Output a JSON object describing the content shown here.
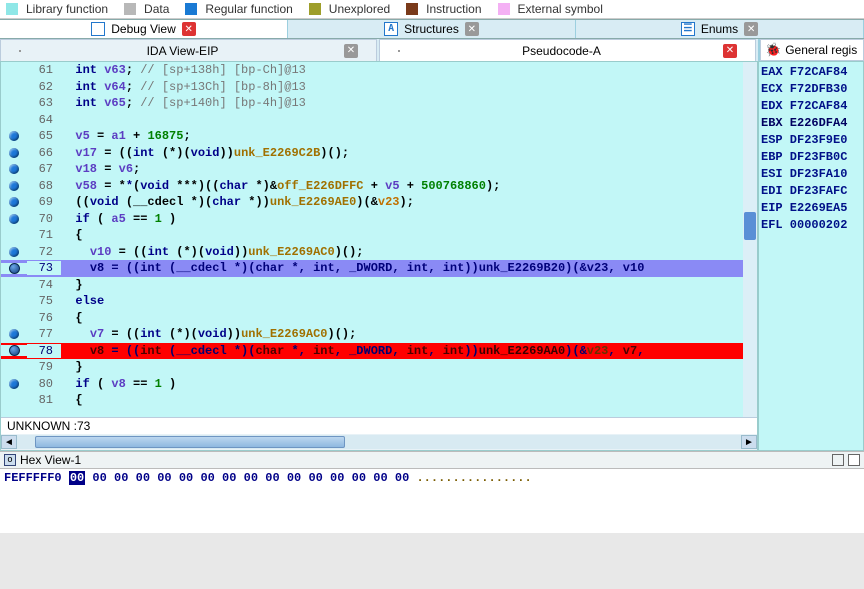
{
  "legend": [
    {
      "color": "#8fe7e7",
      "label": "Library function"
    },
    {
      "color": "#b8b8b8",
      "label": "Data"
    },
    {
      "color": "#1a7ad4",
      "label": "Regular function"
    },
    {
      "color": "#9e9e2a",
      "label": "Unexplored"
    },
    {
      "color": "#7a3a1a",
      "label": "Instruction"
    },
    {
      "color": "#f4b0f4",
      "label": "External symbol"
    }
  ],
  "main_tabs": [
    {
      "icon": "lines",
      "label": "Debug View",
      "close": "red"
    },
    {
      "icon": "A",
      "label": "Structures",
      "close": "gray"
    },
    {
      "icon": "E",
      "label": "Enums",
      "close": "gray"
    }
  ],
  "sub_tabs_left": [
    {
      "icon": "code",
      "label": "IDA View-EIP",
      "close": "gray"
    },
    {
      "icon": "code",
      "label": "Pseudocode-A",
      "close": "red"
    }
  ],
  "reg_tab_label": "General regis",
  "registers": [
    {
      "n": "EAX",
      "v": "F72CAF84"
    },
    {
      "n": "ECX",
      "v": "F72DFB30"
    },
    {
      "n": "EDX",
      "v": "F72CAF84"
    },
    {
      "n": "EBX",
      "v": "E226DFA4"
    },
    {
      "n": "ESP",
      "v": "DF23F9E0"
    },
    {
      "n": "EBP",
      "v": "DF23FB0C"
    },
    {
      "n": "ESI",
      "v": "DF23FA10"
    },
    {
      "n": "EDI",
      "v": "DF23FAFC"
    },
    {
      "n": "EIP",
      "v": "E2269EA5"
    },
    {
      "n": "EFL",
      "v": "00000202"
    }
  ],
  "code_lines": [
    {
      "ln": 61,
      "dot": "",
      "html": "  <span class='tok-kw'>int</span> <span class='tok-var'>v63</span>; <span class='tok-cmt'>// [sp+138h] [bp-Ch]@13</span>"
    },
    {
      "ln": 62,
      "dot": "",
      "html": "  <span class='tok-kw'>int</span> <span class='tok-var'>v64</span>; <span class='tok-cmt'>// [sp+13Ch] [bp-8h]@13</span>"
    },
    {
      "ln": 63,
      "dot": "",
      "html": "  <span class='tok-kw'>int</span> <span class='tok-var'>v65</span>; <span class='tok-cmt'>// [sp+140h] [bp-4h]@13</span>"
    },
    {
      "ln": 64,
      "dot": "",
      "html": ""
    },
    {
      "ln": 65,
      "dot": "d",
      "html": "  <span class='tok-var'>v5</span> = <span class='tok-var'>a1</span> + <span class='tok-num'>16875</span>;"
    },
    {
      "ln": 66,
      "dot": "d",
      "html": "  <span class='tok-var'>v17</span> = ((<span class='tok-kw'>int</span> (*)(<span class='tok-kw'>void</span>))<span class='tok-unk'>unk_E2269C2B</span>)();"
    },
    {
      "ln": 67,
      "dot": "d",
      "html": "  <span class='tok-var'>v18</span> = <span class='tok-var'>v6</span>;"
    },
    {
      "ln": 68,
      "dot": "d",
      "html": "  <span class='tok-var'>v58</span> = *<span class='tok-ptr'>*</span>(<span class='tok-kw'>void</span> ***)((<span class='tok-kw'>char</span> *)&<span class='tok-off'>off_E226DFFC</span> + <span class='tok-var'>v5</span> + <span class='tok-num'>500768860</span>);"
    },
    {
      "ln": 69,
      "dot": "d",
      "html": "  ((<span class='tok-kw'>void</span> (__cdecl *)(<span class='tok-kw'>char</span> *))<span class='tok-unk'>unk_E2269AE0</span>)(&<span class='tok-amp'>v23</span>);"
    },
    {
      "ln": 70,
      "dot": "d",
      "html": "  <span class='tok-kw'>if</span> ( <span class='tok-var'>a5</span> == <span class='tok-num'>1</span> )"
    },
    {
      "ln": 71,
      "dot": "",
      "html": "  {"
    },
    {
      "ln": 72,
      "dot": "d",
      "html": "    <span class='tok-var'>v10</span> = ((<span class='tok-kw'>int</span> (*)(<span class='tok-kw'>void</span>))<span class='tok-unk'>unk_E2269AC0</span>)();"
    },
    {
      "ln": 73,
      "dot": "b",
      "row": "sel",
      "html": "    <span class='tok-var'>v8</span> = ((<span class='tok-kw'>int</span> (__cdecl *)(<span class='tok-kw'>char</span> *, <span class='tok-kw'>int</span>, _DWORD, <span class='tok-kw'>int</span>, <span class='tok-kw'>int</span>))<span class='tok-unk'>unk_E2269B20</span>)(&<span class='tok-amp'>v23</span>, <span class='tok-var'>v10</span>"
    },
    {
      "ln": 74,
      "dot": "",
      "html": "  }"
    },
    {
      "ln": 75,
      "dot": "",
      "html": "  <span class='tok-kw'>else</span>"
    },
    {
      "ln": 76,
      "dot": "",
      "html": "  {"
    },
    {
      "ln": 77,
      "dot": "d",
      "html": "    <span class='tok-var'>v7</span> = ((<span class='tok-kw'>int</span> (*)(<span class='tok-kw'>void</span>))<span class='tok-unk'>unk_E2269AC0</span>)();"
    },
    {
      "ln": 78,
      "dot": "b",
      "row": "red",
      "html": "    <span style='color:#4a0000'>v8</span> = ((<span style='color:#4a0000'>int</span> (__cdecl *)(<span style='color:#4a0000'>char</span> *, <span style='color:#4a0000'>int</span>, _DWORD, <span style='color:#4a0000'>int</span>, <span style='color:#4a0000'>int</span>))<span class='tok-unk2' style='color:#3a0000'>unk_E2269AA0</span>)(&<span style='color:#6a3000'>v23</span>, <span style='color:#4a0000'>v7</span>,"
    },
    {
      "ln": 79,
      "dot": "",
      "html": "  }"
    },
    {
      "ln": 80,
      "dot": "d",
      "html": "  <span class='tok-kw'>if</span> ( <span class='tok-var'>v8</span> == <span class='tok-num'>1</span> )"
    },
    {
      "ln": 81,
      "dot": "",
      "html": "  {"
    }
  ],
  "status_line": "UNKNOWN :73",
  "hex_title": "Hex View-1",
  "hex": {
    "addr": "FEFFFFF0",
    "selected": "00",
    "bytes_rest": " 00 00 00 00 00 00 00  00 00 00 00 00 00 00 00  ",
    "ascii": "................"
  }
}
